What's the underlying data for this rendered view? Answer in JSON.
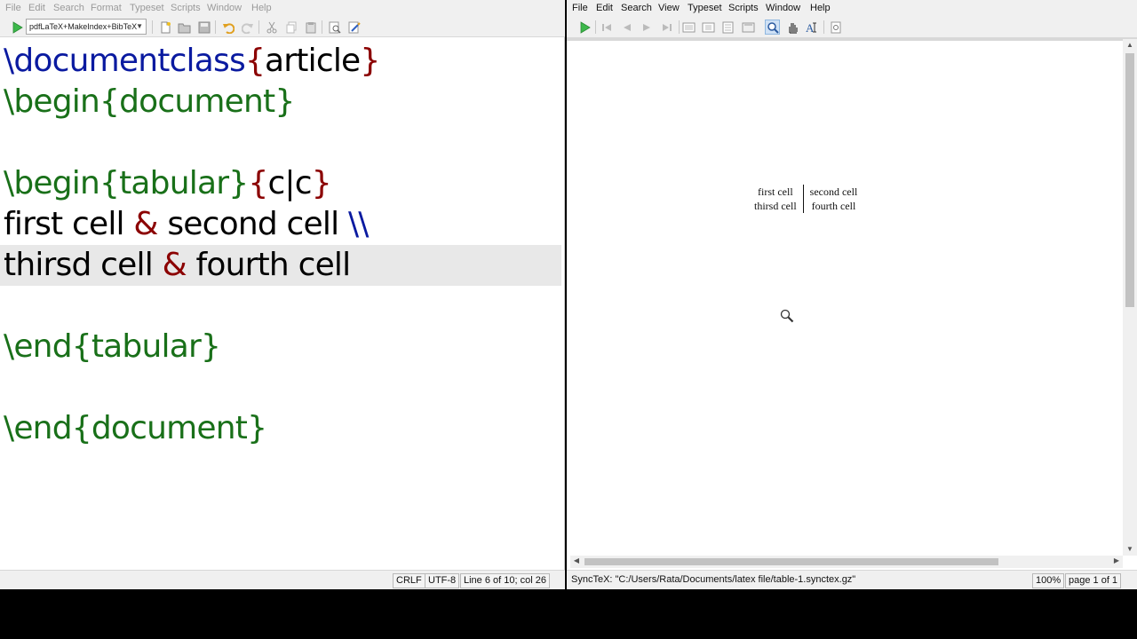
{
  "editor": {
    "menu": [
      "File",
      "Edit",
      "Search",
      "Format",
      "Typeset",
      "Scripts",
      "Window",
      "Help"
    ],
    "engine": "pdfLaTeX+MakeIndex+BibTeX",
    "icons": [
      "typeset-play-icon",
      "new-file-icon",
      "open-folder-icon",
      "save-icon",
      "undo-icon",
      "redo-icon",
      "cut-icon",
      "copy-icon",
      "paste-icon",
      "find-icon",
      "replace-icon"
    ],
    "code": {
      "l1_cmd": "\\documentclass",
      "l1_open": "{",
      "l1_arg": "article",
      "l1_close": "}",
      "l2_cmd": "\\begin",
      "l2_env": "{document}",
      "l4_cmd": "\\begin",
      "l4_env": "{tabular}",
      "l4_open": "{",
      "l4_arg": "c|c",
      "l4_close": "}",
      "l5_a": "first cell ",
      "l5_amp": "&",
      "l5_b": " second cell ",
      "l5_nl": "\\\\",
      "l6_a": "thirsd cell ",
      "l6_amp": "&",
      "l6_b": " fourth cell",
      "l8_cmd": "\\end",
      "l8_env": "{tabular}",
      "l10_cmd": "\\end",
      "l10_env": "{document}"
    },
    "status": {
      "line_ending": "CRLF",
      "encoding": "UTF-8",
      "position": "Line 6 of 10; col 26"
    }
  },
  "preview": {
    "menu": [
      "File",
      "Edit",
      "Search",
      "View",
      "Typeset",
      "Scripts",
      "Window",
      "Help"
    ],
    "icons": [
      "typeset-play-icon",
      "first-page-icon",
      "prev-page-icon",
      "next-page-icon",
      "last-page-icon",
      "single-page-icon",
      "continuous-icon",
      "facing-pages-icon",
      "fit-window-icon",
      "magnify-icon",
      "hand-icon",
      "text-select-icon",
      "fit-width-icon"
    ],
    "table": {
      "rows": [
        [
          "first cell",
          "second cell"
        ],
        [
          "thirsd cell",
          "fourth cell"
        ]
      ]
    },
    "status": {
      "synctex": "SyncTeX: \"C:/Users/Rata/Documents/latex file/table-1.synctex.gz\"",
      "zoom": "100%",
      "page": "page 1 of 1"
    }
  },
  "colors": {
    "keyword": "#0a1aa0",
    "environment": "#197019",
    "bracket": "#8b0000",
    "typeset_green": "#3cb84a"
  }
}
